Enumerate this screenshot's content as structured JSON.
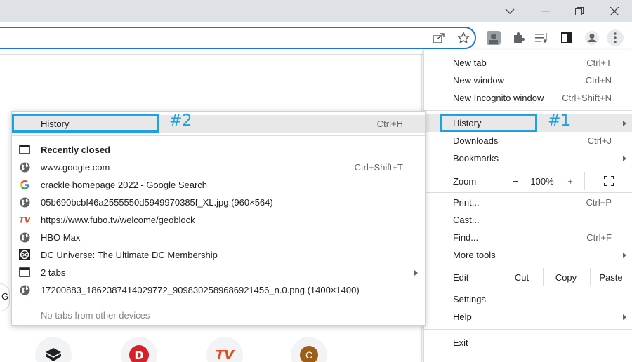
{
  "window": {
    "minimize_glyph": "—",
    "restore_glyph": "❐",
    "close_glyph": "✕",
    "tab_search_glyph": "⌄"
  },
  "toolbar": {
    "icons": [
      "share-icon",
      "star-icon",
      "extension-avatar-icon",
      "puzzle-icon",
      "media-queue-icon",
      "side-panel-icon",
      "profile-icon",
      "more-vert-icon"
    ]
  },
  "page": {
    "partial_text": "G"
  },
  "menu": {
    "new_tab": {
      "label": "New tab",
      "shortcut": "Ctrl+T"
    },
    "new_window": {
      "label": "New window",
      "shortcut": "Ctrl+N"
    },
    "new_incognito": {
      "label": "New Incognito window",
      "shortcut": "Ctrl+Shift+N"
    },
    "history": {
      "label": "History"
    },
    "downloads": {
      "label": "Downloads",
      "shortcut": "Ctrl+J"
    },
    "bookmarks": {
      "label": "Bookmarks"
    },
    "zoom": {
      "label": "Zoom",
      "minus": "−",
      "value": "100%",
      "plus": "+"
    },
    "print": {
      "label": "Print...",
      "shortcut": "Ctrl+P"
    },
    "cast": {
      "label": "Cast..."
    },
    "find": {
      "label": "Find...",
      "shortcut": "Ctrl+F"
    },
    "more_tools": {
      "label": "More tools"
    },
    "edit": {
      "label": "Edit",
      "cut": "Cut",
      "copy": "Copy",
      "paste": "Paste"
    },
    "settings": {
      "label": "Settings"
    },
    "help": {
      "label": "Help"
    },
    "exit": {
      "label": "Exit"
    }
  },
  "annotations": {
    "tag1": "#1",
    "tag2": "#2",
    "highlight_color": "#1ea1e1"
  },
  "history_submenu": {
    "history": {
      "label": "History",
      "shortcut": "Ctrl+H"
    },
    "recently_closed": {
      "label": "Recently closed"
    },
    "items": [
      {
        "label": "www.google.com",
        "shortcut": "Ctrl+Shift+T",
        "icon": "globe-icon"
      },
      {
        "label": "crackle homepage 2022 - Google Search",
        "icon": "google-g-icon"
      },
      {
        "label": "05b690bcbf46a2555550d5949970385f_XL.jpg (960×564)",
        "icon": "globe-icon"
      },
      {
        "label": "https://www.fubo.tv/welcome/geoblock",
        "icon": "fubo-tv-icon"
      },
      {
        "label": "HBO Max",
        "icon": "globe-icon"
      },
      {
        "label": "DC Universe: The Ultimate DC Membership",
        "icon": "dc-universe-icon"
      },
      {
        "label": "2 tabs",
        "icon": "window-icon"
      },
      {
        "label": "17200883_1862387414029772_9098302589686921456_n.0.png (1400×1400)",
        "icon": "globe-icon"
      }
    ],
    "no_tabs": "No tabs from other devices"
  },
  "shortcuts": {
    "fubo_text": "TV",
    "c_text": "C"
  }
}
